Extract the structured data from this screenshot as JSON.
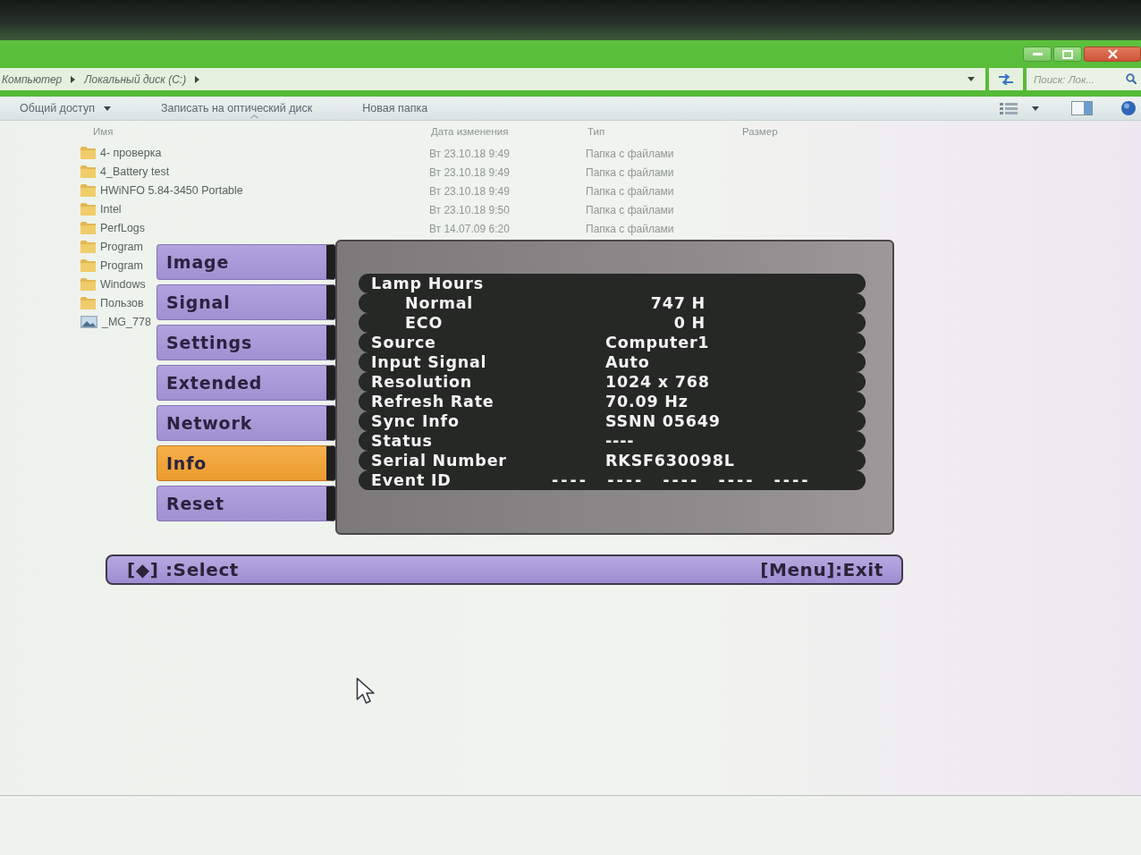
{
  "explorer": {
    "address": {
      "path": [
        "Компьютер",
        "Локальный диск (C:)"
      ]
    },
    "search": {
      "placeholder": "Поиск: Лок..."
    },
    "commands": [
      {
        "label": "Общий доступ",
        "kind": "dropdown"
      },
      {
        "label": "Записать на оптический диск",
        "kind": "plain"
      },
      {
        "label": "Новая папка",
        "kind": "plain"
      }
    ],
    "columns": [
      "Имя",
      "Дата изменения",
      "Тип",
      "Размер"
    ],
    "files": [
      {
        "kind": "folder",
        "name": "4- проверка",
        "modified": "Вт 23.10.18 9:49",
        "type": "Папка с файлами"
      },
      {
        "kind": "folder",
        "name": "4_Battery test",
        "modified": "Вт 23.10.18 9:49",
        "type": "Папка с файлами"
      },
      {
        "kind": "folder",
        "name": "HWiNFO 5.84-3450 Portable",
        "modified": "Вт 23.10.18 9:49",
        "type": "Папка с файлами"
      },
      {
        "kind": "folder",
        "name": "Intel",
        "modified": "Вт 23.10.18 9:50",
        "type": "Папка с файлами"
      },
      {
        "kind": "folder",
        "name": "PerfLogs",
        "modified": "Вт 14.07.09 6:20",
        "type": "Папка с файлами"
      },
      {
        "kind": "folder",
        "name": "Program"
      },
      {
        "kind": "folder",
        "name": "Program"
      },
      {
        "kind": "folder",
        "name": "Windows"
      },
      {
        "kind": "folder",
        "name": "Пользов"
      },
      {
        "kind": "image",
        "name": "_MG_778"
      }
    ]
  },
  "osd": {
    "tabs": [
      {
        "label": "Image",
        "selected": false
      },
      {
        "label": "Signal",
        "selected": false
      },
      {
        "label": "Settings",
        "selected": false
      },
      {
        "label": "Extended",
        "selected": false
      },
      {
        "label": "Network",
        "selected": false
      },
      {
        "label": "Info",
        "selected": true
      },
      {
        "label": "Reset",
        "selected": false
      }
    ],
    "info": [
      {
        "kind": "heading",
        "label": "Lamp Hours"
      },
      {
        "kind": "sub",
        "label": "Normal",
        "value": "747 H"
      },
      {
        "kind": "sub",
        "label": "ECO",
        "value": "0 H"
      },
      {
        "kind": "field",
        "label": "Source",
        "value": "Computer1"
      },
      {
        "kind": "field",
        "label": "Input Signal",
        "value": "Auto"
      },
      {
        "kind": "field",
        "label": "Resolution",
        "value": "1024 x 768"
      },
      {
        "kind": "field",
        "label": "Refresh Rate",
        "value": "70.09 Hz"
      },
      {
        "kind": "field",
        "label": "Sync Info",
        "value": "SSNN 05649"
      },
      {
        "kind": "field",
        "label": "Status",
        "value": "----"
      },
      {
        "kind": "field",
        "label": "Serial Number",
        "value": "RKSF630098L"
      },
      {
        "kind": "wide",
        "label": "Event ID",
        "value": "---- ---- ---- ---- ----"
      }
    ],
    "footer": {
      "select": "[◆] :Select",
      "exit": "[Menu]:Exit"
    }
  }
}
